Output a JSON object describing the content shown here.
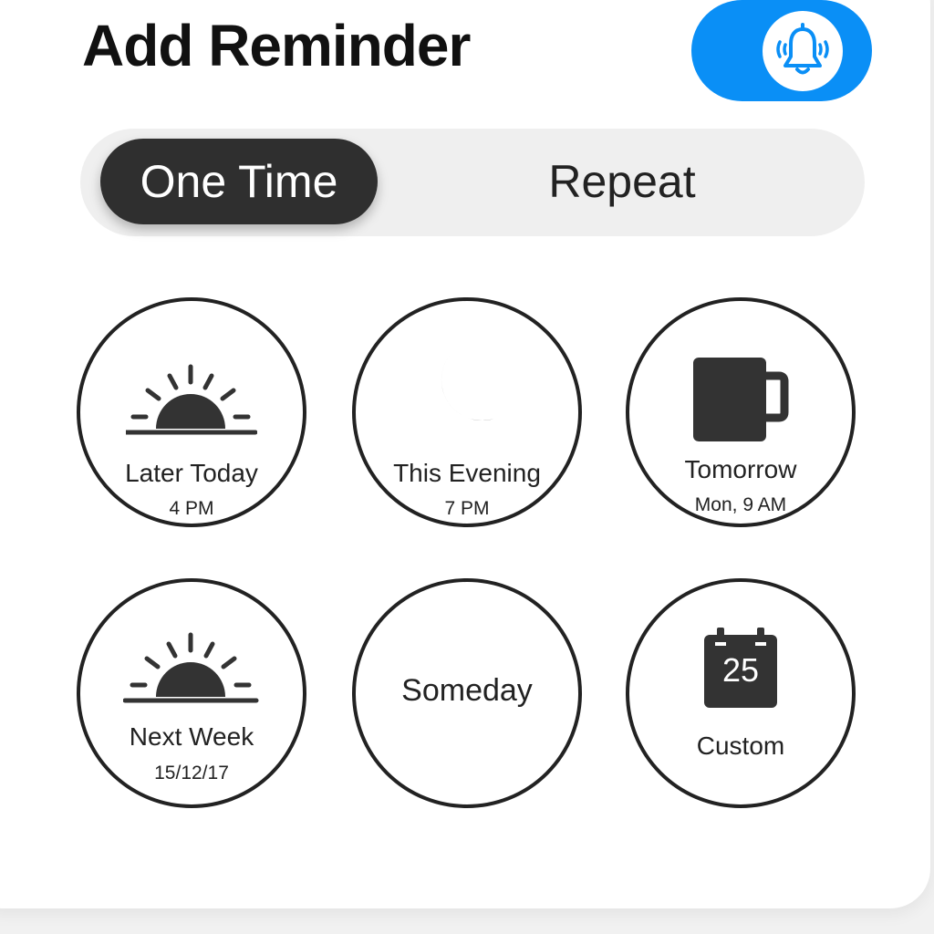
{
  "header": {
    "title": "Add Reminder",
    "alert_toggle": {
      "on": true,
      "icon": "bell-ringing-icon",
      "color": "#0a8ff6"
    }
  },
  "mode_tabs": {
    "selected": "One Time",
    "items": [
      {
        "label": "One Time",
        "active": true
      },
      {
        "label": "Repeat",
        "active": false
      }
    ]
  },
  "options": [
    {
      "label": "Later Today",
      "sublabel": "4 PM",
      "icon": "sunrise-icon"
    },
    {
      "label": "This Evening",
      "sublabel": "7 PM",
      "icon": "moon-icon"
    },
    {
      "label": "Tomorrow",
      "sublabel": "Mon, 9 AM",
      "icon": "coffee-mug-icon"
    },
    {
      "label": "Next Week",
      "sublabel": "15/12/17",
      "icon": "sunrise-icon"
    },
    {
      "label": "Someday",
      "icon": "none"
    },
    {
      "label": "Custom",
      "icon": "calendar-icon",
      "calendar_day": "25"
    }
  ],
  "colors": {
    "accent": "#0a8ff6",
    "active_tab": "#2f2f2f",
    "icon": "#333333"
  }
}
